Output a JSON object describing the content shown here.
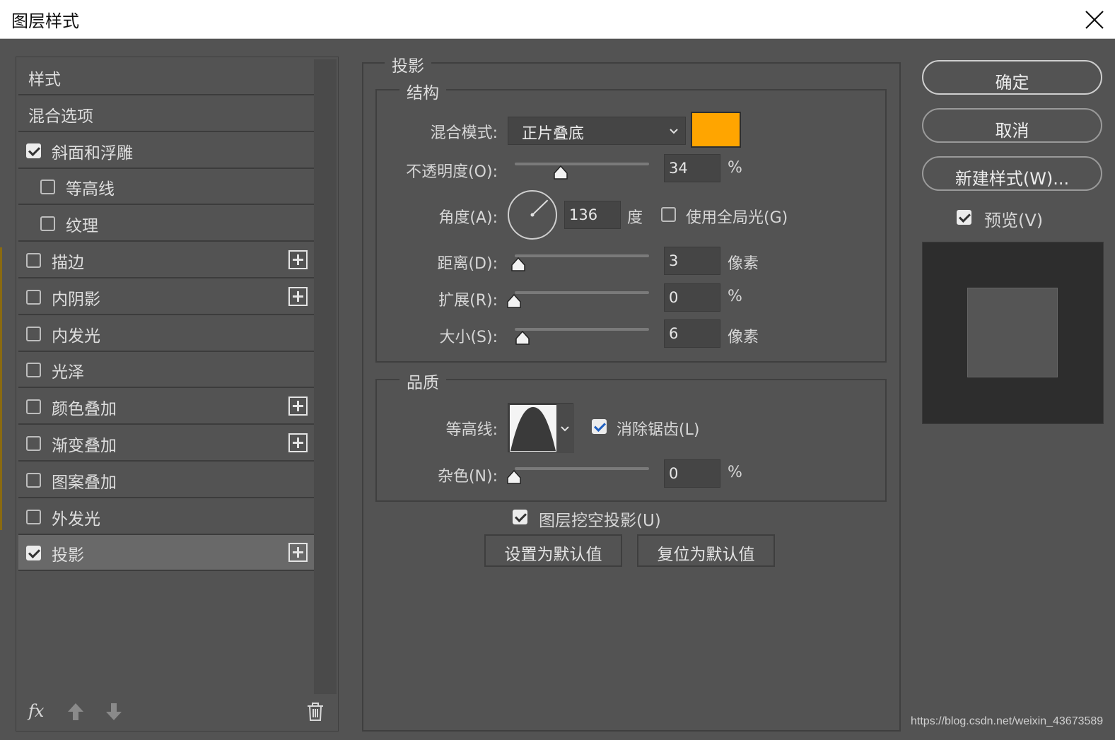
{
  "window": {
    "title": "图层样式"
  },
  "style_list": {
    "items": [
      {
        "label": "样式",
        "checkbox": null,
        "has_plus": false,
        "selected": false
      },
      {
        "label": "混合选项",
        "checkbox": null,
        "has_plus": false,
        "selected": false
      },
      {
        "label": "斜面和浮雕",
        "checkbox": true,
        "has_plus": false,
        "selected": false
      },
      {
        "label": "等高线",
        "checkbox": false,
        "has_plus": false,
        "selected": false
      },
      {
        "label": "纹理",
        "checkbox": false,
        "has_plus": false,
        "selected": false
      },
      {
        "label": "描边",
        "checkbox": false,
        "has_plus": true,
        "selected": false
      },
      {
        "label": "内阴影",
        "checkbox": false,
        "has_plus": true,
        "selected": false
      },
      {
        "label": "内发光",
        "checkbox": false,
        "has_plus": false,
        "selected": false
      },
      {
        "label": "光泽",
        "checkbox": false,
        "has_plus": false,
        "selected": false
      },
      {
        "label": "颜色叠加",
        "checkbox": false,
        "has_plus": true,
        "selected": false
      },
      {
        "label": "渐变叠加",
        "checkbox": false,
        "has_plus": true,
        "selected": false
      },
      {
        "label": "图案叠加",
        "checkbox": false,
        "has_plus": false,
        "selected": false
      },
      {
        "label": "外发光",
        "checkbox": false,
        "has_plus": false,
        "selected": false
      },
      {
        "label": "投影",
        "checkbox": true,
        "has_plus": true,
        "selected": true
      }
    ],
    "footer_fx": "fx"
  },
  "drop_shadow": {
    "group_title": "投影",
    "structure": {
      "title": "结构",
      "blend_mode_label": "混合模式:",
      "blend_mode_value": "正片叠底",
      "shadow_color": "#ffa500",
      "opacity_label": "不透明度(O):",
      "opacity_value": "34",
      "opacity_unit": "%",
      "opacity_level": 0.34,
      "angle_label": "角度(A):",
      "angle_value": "136",
      "angle_unit": "度",
      "global_light_label": "使用全局光(G)",
      "global_light_checked": false,
      "distance_label": "距离(D):",
      "distance_value": "3",
      "distance_unit": "像素",
      "spread_label": "扩展(R):",
      "spread_value": "0",
      "spread_unit": "%",
      "size_label": "大小(S):",
      "size_value": "6",
      "size_unit": "像素"
    },
    "quality": {
      "title": "品质",
      "contour_label": "等高线:",
      "anti_alias_label": "消除锯齿(L)",
      "anti_alias_checked": true,
      "noise_label": "杂色(N):",
      "noise_value": "0",
      "noise_unit": "%"
    },
    "knockout_label": "图层挖空投影(U)",
    "knockout_checked": true,
    "make_default_label": "设置为默认值",
    "reset_default_label": "复位为默认值"
  },
  "actions": {
    "ok_label": "确定",
    "cancel_label": "取消",
    "new_style_label": "新建样式(W)...",
    "preview_label": "预览(V)",
    "preview_checked": true
  },
  "watermark": "https://blog.csdn.net/weixin_43673589"
}
